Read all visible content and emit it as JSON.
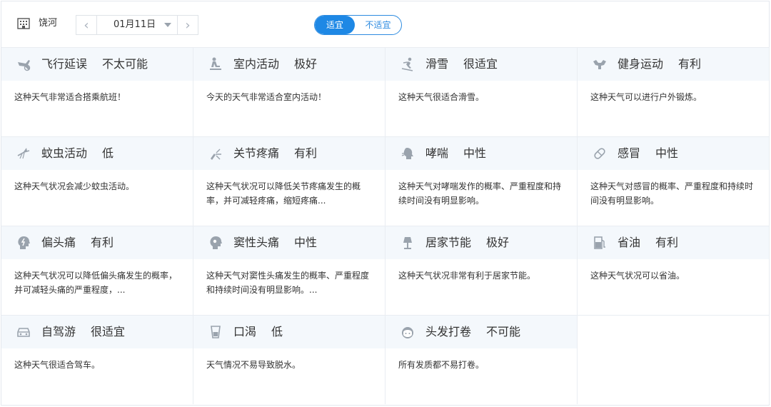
{
  "header": {
    "city": "饶河",
    "date": "01月11日",
    "toggle": {
      "active": "适宜",
      "inactive": "不适宜"
    }
  },
  "colors": {
    "accent": "#1e88e5",
    "head_bg": "#f4f8fc",
    "icon": "#9aa3ad"
  },
  "items": [
    {
      "icon": "airplane-icon",
      "title": "飞行延误",
      "level": "不太可能",
      "desc": "这种天气非常适合搭乘航班！"
    },
    {
      "icon": "indoor-icon",
      "title": "室内活动",
      "level": "极好",
      "desc": "今天的天气非常适合室内活动！"
    },
    {
      "icon": "skiing-icon",
      "title": "滑雪",
      "level": "很适宜",
      "desc": "这种天气很适合滑雪。"
    },
    {
      "icon": "fitness-icon",
      "title": "健身运动",
      "level": "有利",
      "desc": "这种天气可以进行户外锻炼。"
    },
    {
      "icon": "mosquito-icon",
      "title": "蚊虫活动",
      "level": "低",
      "desc": "这种天气状况会减少蚊虫活动。"
    },
    {
      "icon": "joint-pain-icon",
      "title": "关节疼痛",
      "level": "有利",
      "desc": "这种天气状况可以降低关节疼痛发生的概率，并可减轻疼痛，缩短疼痛..."
    },
    {
      "icon": "asthma-icon",
      "title": "哮喘",
      "level": "中性",
      "desc": "这种天气对哮喘发作的概率、严重程度和持续时间没有明显影响。"
    },
    {
      "icon": "cold-pill-icon",
      "title": "感冒",
      "level": "中性",
      "desc": "这种天气对感冒的概率、严重程度和持续时间没有明显影响。"
    },
    {
      "icon": "migraine-icon",
      "title": "偏头痛",
      "level": "有利",
      "desc": "这种天气状况可以降低偏头痛发生的概率，并可减轻头痛的严重程度，..."
    },
    {
      "icon": "sinus-headache-icon",
      "title": "窦性头痛",
      "level": "中性",
      "desc": "这种天气对窦性头痛发生的概率、严重程度和持续时间没有明显影响。..."
    },
    {
      "icon": "lamp-icon",
      "title": "居家节能",
      "level": "极好",
      "desc": "这种天气状况非常有利于居家节能。"
    },
    {
      "icon": "fuel-icon",
      "title": "省油",
      "level": "有利",
      "desc": "这种天气状况可以省油。"
    },
    {
      "icon": "car-icon",
      "title": "自驾游",
      "level": "很适宜",
      "desc": "这种天气很适合驾车。"
    },
    {
      "icon": "cup-icon",
      "title": "口渴",
      "level": "低",
      "desc": "天气情况不易导致脱水。"
    },
    {
      "icon": "hair-icon",
      "title": "头发打卷",
      "level": "不可能",
      "desc": "所有发质都不易打卷。"
    }
  ]
}
